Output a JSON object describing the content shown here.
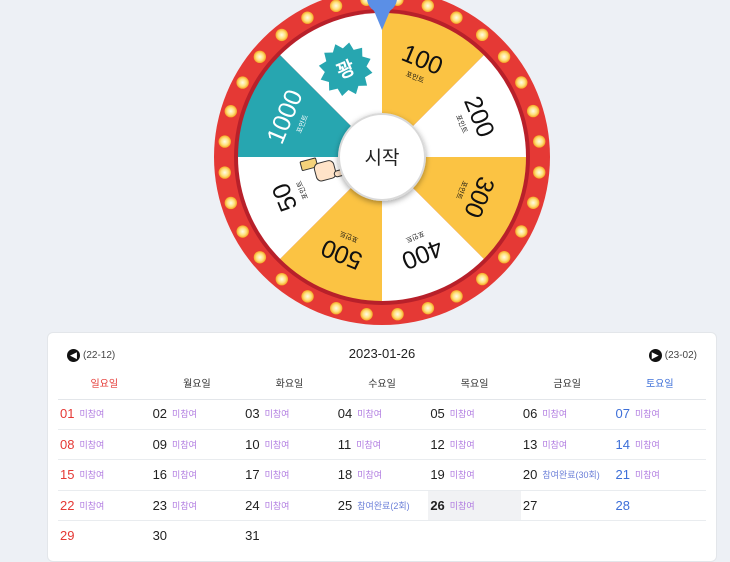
{
  "wheel": {
    "start_label": "시작",
    "rim_color": "#e53935",
    "pointer_color": "#5b8fe6",
    "segments": [
      {
        "value": "100",
        "unit": "포인트",
        "color": "#fbc343",
        "type": "points"
      },
      {
        "value": "200",
        "unit": "포인트",
        "color": "#ffffff",
        "type": "points"
      },
      {
        "value": "300",
        "unit": "포인트",
        "color": "#fbc343",
        "type": "points"
      },
      {
        "value": "400",
        "unit": "포인트",
        "color": "#ffffff",
        "type": "points"
      },
      {
        "value": "500",
        "unit": "포인트",
        "color": "#fbc343",
        "type": "points"
      },
      {
        "value": "50",
        "unit": "포인트",
        "color": "#ffffff",
        "type": "points"
      },
      {
        "value": "1000",
        "unit": "포인트",
        "color": "#27a6b0",
        "type": "points"
      },
      {
        "value": "꽝",
        "unit": "",
        "color": "#ffffff",
        "type": "miss"
      }
    ]
  },
  "calendar": {
    "title": "2023-01-26",
    "prev_label": "(22-12)",
    "next_label": "(23-02)",
    "weekdays": [
      "일요일",
      "월요일",
      "화요일",
      "수요일",
      "목요일",
      "금요일",
      "토요일"
    ],
    "weeks": [
      [
        {
          "day": "01",
          "status": "미참여"
        },
        {
          "day": "02",
          "status": "미참여"
        },
        {
          "day": "03",
          "status": "미참여"
        },
        {
          "day": "04",
          "status": "미참여"
        },
        {
          "day": "05",
          "status": "미참여"
        },
        {
          "day": "06",
          "status": "미참여"
        },
        {
          "day": "07",
          "status": "미참여"
        }
      ],
      [
        {
          "day": "08",
          "status": "미참여"
        },
        {
          "day": "09",
          "status": "미참여"
        },
        {
          "day": "10",
          "status": "미참여"
        },
        {
          "day": "11",
          "status": "미참여"
        },
        {
          "day": "12",
          "status": "미참여"
        },
        {
          "day": "13",
          "status": "미참여"
        },
        {
          "day": "14",
          "status": "미참여"
        }
      ],
      [
        {
          "day": "15",
          "status": "미참여"
        },
        {
          "day": "16",
          "status": "미참여"
        },
        {
          "day": "17",
          "status": "미참여"
        },
        {
          "day": "18",
          "status": "미참여"
        },
        {
          "day": "19",
          "status": "미참여"
        },
        {
          "day": "20",
          "status": "참여완료(30회)"
        },
        {
          "day": "21",
          "status": "미참여"
        }
      ],
      [
        {
          "day": "22",
          "status": "미참여"
        },
        {
          "day": "23",
          "status": "미참여"
        },
        {
          "day": "24",
          "status": "미참여"
        },
        {
          "day": "25",
          "status": "참여완료(2회)"
        },
        {
          "day": "26",
          "status": "미참여",
          "today": true
        },
        {
          "day": "27",
          "status": ""
        },
        {
          "day": "28",
          "status": ""
        }
      ],
      [
        {
          "day": "29",
          "status": ""
        },
        {
          "day": "30",
          "status": ""
        },
        {
          "day": "31",
          "status": ""
        },
        {
          "day": "",
          "status": ""
        },
        {
          "day": "",
          "status": ""
        },
        {
          "day": "",
          "status": ""
        },
        {
          "day": "",
          "status": ""
        }
      ]
    ]
  }
}
